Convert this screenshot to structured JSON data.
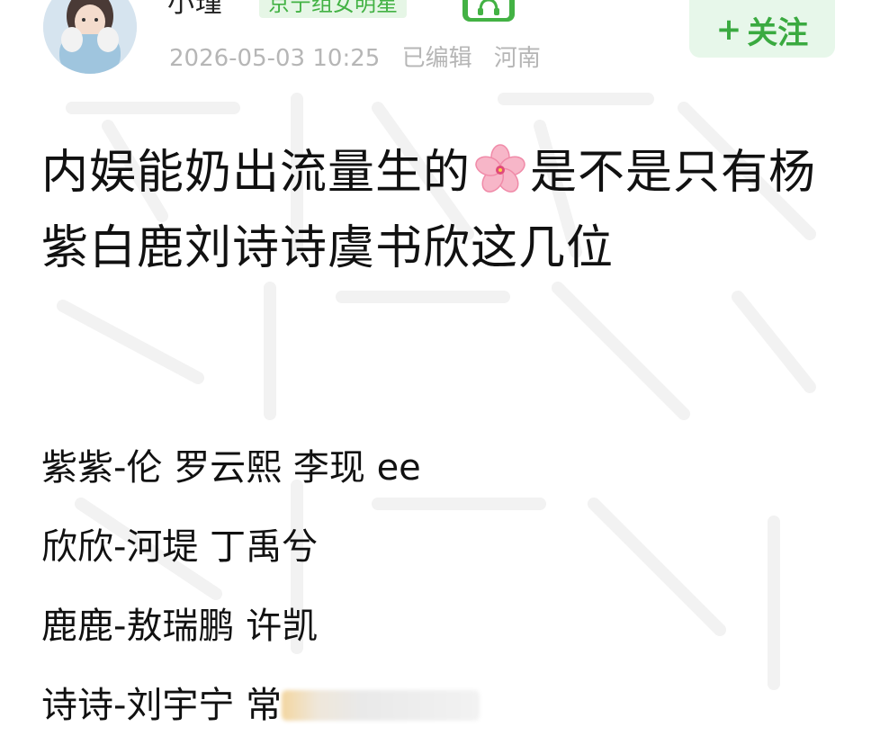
{
  "header": {
    "username": "小瑾",
    "group_badge": "京宁组女明星",
    "level_icon": "headphone-level-badge-icon",
    "timestamp": "2026-05-03 10:25",
    "edited": "已编辑",
    "location": "河南",
    "follow_label": "关注",
    "follow_plus": "+"
  },
  "post": {
    "title_part1": "内娱能奶出流量生的",
    "title_emoji": "cherry-blossom-icon",
    "title_part2": "是不是只有杨紫白鹿刘诗诗虞书欣这几位",
    "lines": [
      "紫紫-伦 罗云熙 李现 ee",
      "欣欣-河堤 丁禹兮",
      "鹿鹿-敖瑞鹏 许凯",
      "诗诗-刘宇宁 常"
    ]
  },
  "colors": {
    "accent_green": "#43b244",
    "follow_bg": "#e7f7ea",
    "meta_gray": "#b6b6b6",
    "text": "#111111"
  }
}
